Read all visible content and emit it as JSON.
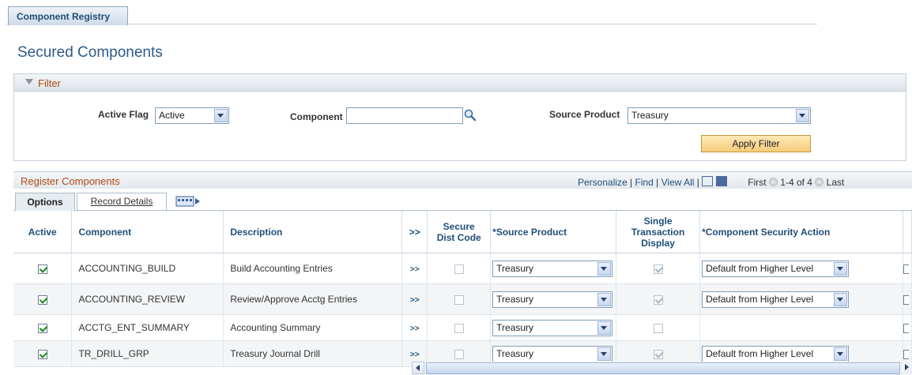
{
  "tabs": {
    "component_registry": "Component Registry"
  },
  "page_title": "Secured Components",
  "filter": {
    "title": "Filter",
    "active_flag_label": "Active Flag",
    "active_flag_value": "Active",
    "component_label": "Component",
    "component_value": "",
    "source_product_label": "Source Product",
    "source_product_value": "Treasury",
    "apply_button": "Apply Filter"
  },
  "grid": {
    "title": "Register Components",
    "personalize": "Personalize",
    "find": "Find",
    "view_all": "View All",
    "first": "First",
    "range": "1-4 of 4",
    "last": "Last",
    "tab_options": "Options",
    "tab_record_details": "Record Details",
    "columns": {
      "active": "Active",
      "component": "Component",
      "description": "Description",
      "expand": ">>",
      "secure_dist_code_1": "Secure",
      "secure_dist_code_2": "Dist Code",
      "source_product": "*Source Product",
      "single_1": "Single",
      "single_2": "Transaction",
      "single_3": "Display",
      "security_action": "*Component Security Action"
    },
    "rows": [
      {
        "active": true,
        "component": "ACCOUNTING_BUILD",
        "description": "Build Accounting Entries",
        "link": ">>",
        "secure_dist_code": false,
        "source_product": "Treasury",
        "single_transaction": true,
        "security_action": "Default from Higher Level"
      },
      {
        "active": true,
        "component": "ACCOUNTING_REVIEW",
        "description": "Review/Approve Acctg Entries",
        "link": ">>",
        "secure_dist_code": false,
        "source_product": "Treasury",
        "single_transaction": true,
        "security_action": "Default from Higher Level"
      },
      {
        "active": true,
        "component": "ACCTG_ENT_SUMMARY",
        "description": "Accounting Summary",
        "link": ">>",
        "secure_dist_code": false,
        "source_product": "Treasury",
        "single_transaction": false,
        "security_action": ""
      },
      {
        "active": true,
        "component": "TR_DRILL_GRP",
        "description": "Treasury Journal Drill",
        "link": ">>",
        "secure_dist_code": false,
        "source_product": "Treasury",
        "single_transaction": true,
        "security_action": "Default from Higher Level"
      }
    ]
  },
  "colors": {
    "title_blue": "#2d5a8a",
    "section_orange": "#b04a14",
    "check_green": "#1a8a1a"
  }
}
